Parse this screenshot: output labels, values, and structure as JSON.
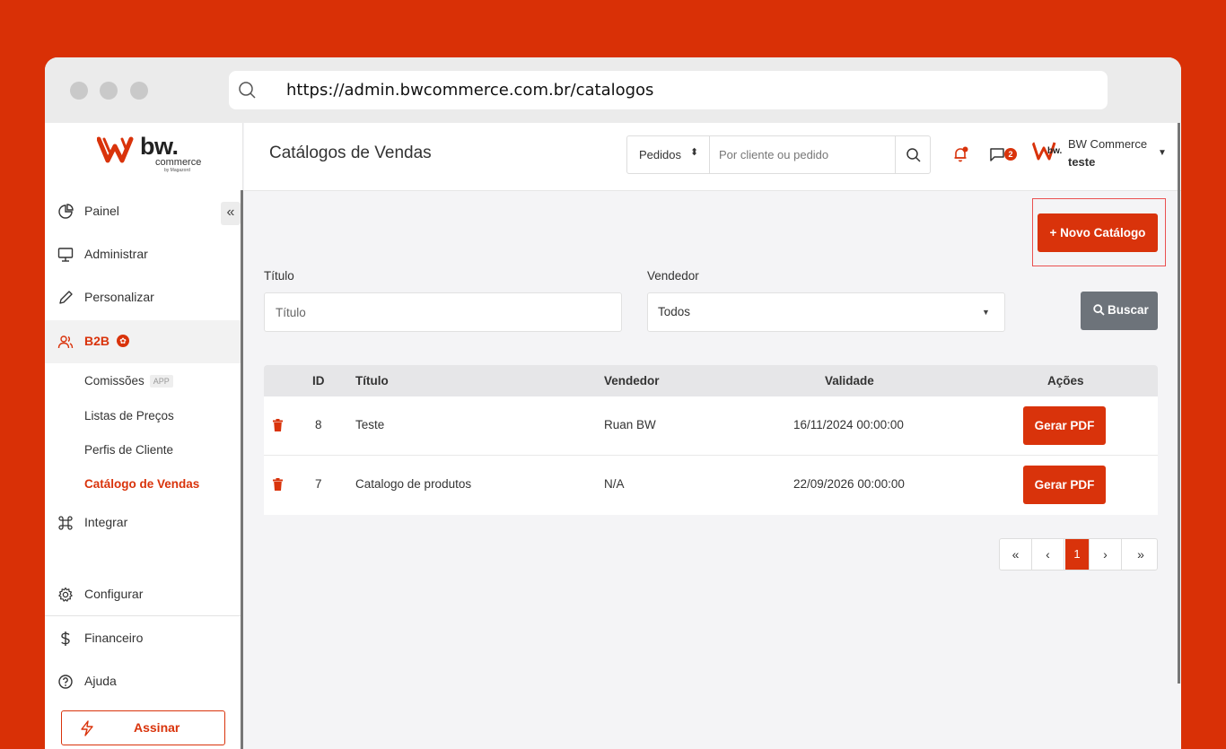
{
  "browser": {
    "url": "https://admin.bwcommerce.com.br/catalogos"
  },
  "logo": {
    "brand": "bw.",
    "sub": "commerce",
    "sub2": "by Magazord"
  },
  "sidebar": {
    "items": [
      {
        "label": "Painel",
        "icon": "pie-chart-icon"
      },
      {
        "label": "Administrar",
        "icon": "monitor-icon"
      },
      {
        "label": "Personalizar",
        "icon": "pen-icon"
      },
      {
        "label": "B2B",
        "icon": "users-icon"
      },
      {
        "label": "Integrar",
        "icon": "command-icon"
      },
      {
        "label": "Configurar",
        "icon": "gear-icon"
      },
      {
        "label": "Financeiro",
        "icon": "dollar-icon"
      },
      {
        "label": "Ajuda",
        "icon": "help-icon"
      }
    ],
    "b2b_badge": "✿",
    "subitems": [
      {
        "label": "Comissões",
        "tag": "APP"
      },
      {
        "label": "Listas de Preços"
      },
      {
        "label": "Perfis de Cliente"
      },
      {
        "label": "Catálogo de Vendas"
      }
    ],
    "collapse_glyph": "«",
    "assinar_label": "Assinar"
  },
  "header": {
    "title": "Catálogos de Vendas",
    "search_type": "Pedidos",
    "search_placeholder": "Por cliente ou pedido",
    "chat_count": "2",
    "user_name": "BW Commerce",
    "user_sub": "teste"
  },
  "main": {
    "new_button": "+ Novo Catálogo",
    "filter": {
      "title_label": "Título",
      "title_placeholder": "Título",
      "seller_label": "Vendedor",
      "seller_value": "Todos",
      "search_button": "Buscar"
    },
    "table": {
      "headers": {
        "id": "ID",
        "title": "Título",
        "seller": "Vendedor",
        "validity": "Validade",
        "actions": "Ações"
      },
      "rows": [
        {
          "id": "8",
          "title": "Teste",
          "seller": "Ruan BW",
          "validity": "16/11/2024 00:00:00",
          "action": "Gerar PDF"
        },
        {
          "id": "7",
          "title": "Catalogo de produtos",
          "seller": "N/A",
          "validity": "22/09/2026 00:00:00",
          "action": "Gerar PDF"
        }
      ]
    },
    "pagination": {
      "first": "«",
      "prev": "‹",
      "current": "1",
      "next": "›",
      "last": "»"
    }
  },
  "colors": {
    "accent": "#d9330b",
    "background": "#d93006",
    "secondary_button": "#6d737a"
  }
}
